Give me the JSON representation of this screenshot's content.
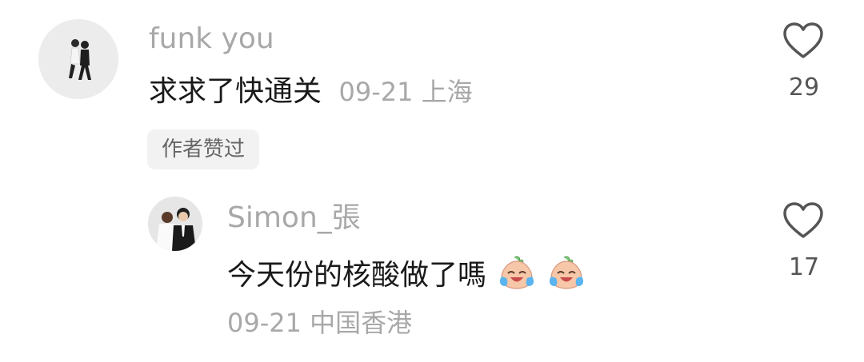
{
  "comments": [
    {
      "username": "funk you",
      "text": "求求了快通关",
      "meta": "09-21 上海",
      "badge": "作者赞过",
      "like_count": "29"
    },
    {
      "username": "Simon_張",
      "text": "今天份的核酸做了嗎",
      "meta": "09-21 中国香港",
      "like_count": "17",
      "emoji": [
        "crying-laughing-emoji",
        "crying-laughing-emoji"
      ]
    }
  ],
  "colors": {
    "username": "#a8a8a8",
    "text": "#1a1a1a",
    "badge_bg": "#f2f2f2",
    "icon": "#555555"
  }
}
